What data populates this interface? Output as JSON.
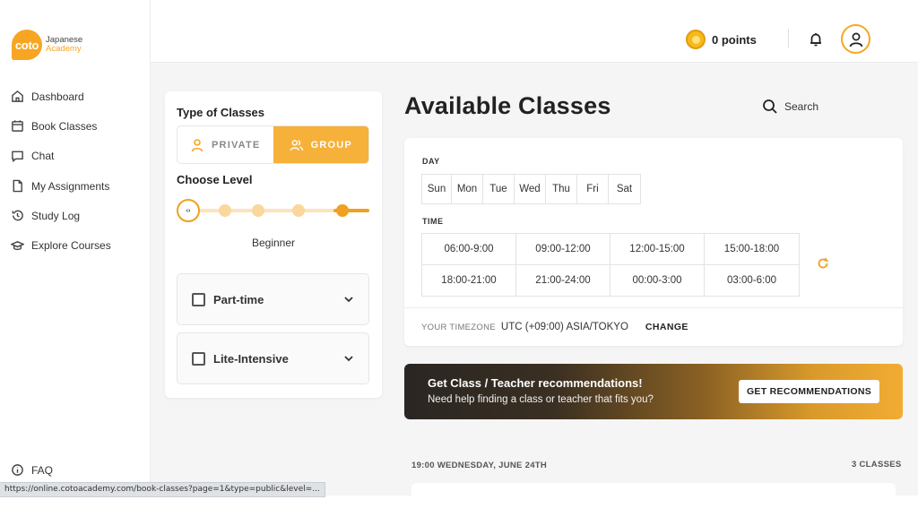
{
  "brand": {
    "badge": "coto",
    "line1": "Japanese",
    "line2": "Academy",
    "accent": "#f6a623"
  },
  "sidebar": {
    "items": [
      {
        "label": "Dashboard",
        "icon": "home-icon"
      },
      {
        "label": "Book Classes",
        "icon": "calendar-icon"
      },
      {
        "label": "Chat",
        "icon": "chat-icon"
      },
      {
        "label": "My Assignments",
        "icon": "document-icon"
      },
      {
        "label": "Study Log",
        "icon": "history-icon"
      },
      {
        "label": "Explore Courses",
        "icon": "graduation-cap-icon"
      }
    ],
    "faq": "FAQ"
  },
  "header": {
    "points": "0 points"
  },
  "status_url": "https://online.cotoacademy.com/book-classes?page=1&type=public&level=...",
  "filter": {
    "type_title": "Type of Classes",
    "private_label": "PRIVATE",
    "group_label": "GROUP",
    "level_title": "Choose Level",
    "level_label": "Beginner",
    "level_index": 0,
    "level_steps": 5,
    "options": [
      {
        "label": "Part-time",
        "checked": false
      },
      {
        "label": "Lite-Intensive",
        "checked": false
      }
    ]
  },
  "main": {
    "title": "Available Classes",
    "search_label": "Search",
    "day_label": "DAY",
    "days": [
      "Sun",
      "Mon",
      "Tue",
      "Wed",
      "Thu",
      "Fri",
      "Sat"
    ],
    "time_label": "TIME",
    "times": [
      "06:00-9:00",
      "09:00-12:00",
      "12:00-15:00",
      "15:00-18:00",
      "18:00-21:00",
      "21:00-24:00",
      "00:00-3:00",
      "03:00-6:00"
    ],
    "timezone_label": "YOUR TIMEZONE",
    "timezone_value": "UTC (+09:00) ASIA/TOKYO",
    "change_label": "CHANGE"
  },
  "banner": {
    "title": "Get Class / Teacher recommendations!",
    "subtitle": "Need help finding a class or teacher that fits you?",
    "button": "GET RECOMMENDATIONS"
  },
  "listing": {
    "date_heading": "19:00 WEDNESDAY, JUNE 24TH",
    "count": "3 CLASSES"
  }
}
